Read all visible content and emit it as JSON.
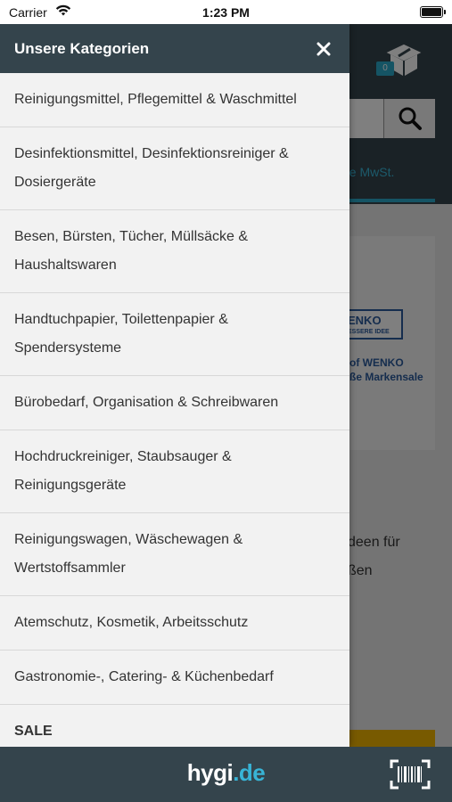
{
  "status_bar": {
    "carrier": "Carrier",
    "time": "1:23 PM",
    "wifi_icon": "wifi-icon",
    "battery_icon": "battery-icon"
  },
  "background": {
    "cart_count": "0",
    "tab_text": "ne MwSt.",
    "brand_logo": "ENKO",
    "brand_slogan": "ESSERE IDEE",
    "brand_text_line1": "of WENKO",
    "brand_text_line2": "ße Markensale",
    "promo_line1": "deen für",
    "promo_line2": "ßen"
  },
  "drawer": {
    "title": "Unsere Kategorien",
    "close_icon": "close-icon",
    "categories": [
      "Reinigungsmittel, Pflegemittel & Waschmittel",
      "Desinfektionsmittel, Desinfektionsreiniger & Dosiergeräte",
      "Besen, Bürsten, Tücher, Müllsäcke & Haushaltswaren",
      "Handtuchpapier, Toilettenpapier & Spendersysteme",
      "Bürobedarf, Organisation & Schreibwaren",
      "Hochdruckreiniger, Staubsauger & Reinigungsgeräte",
      "Reinigungswagen, Wäschewagen & Wertstoffsammler",
      "Atemschutz, Kosmetik, Arbeitsschutz",
      "Gastronomie-, Catering- & Küchenbedarf",
      "SALE"
    ]
  },
  "bottom_bar": {
    "logo_main": "hygi",
    "logo_dot": ".",
    "logo_tld": "de",
    "scan_icon": "barcode-scanner-icon"
  },
  "colors": {
    "header_bg": "#34444c",
    "accent": "#2aa8c8",
    "drawer_bg": "#f2f2f2"
  }
}
